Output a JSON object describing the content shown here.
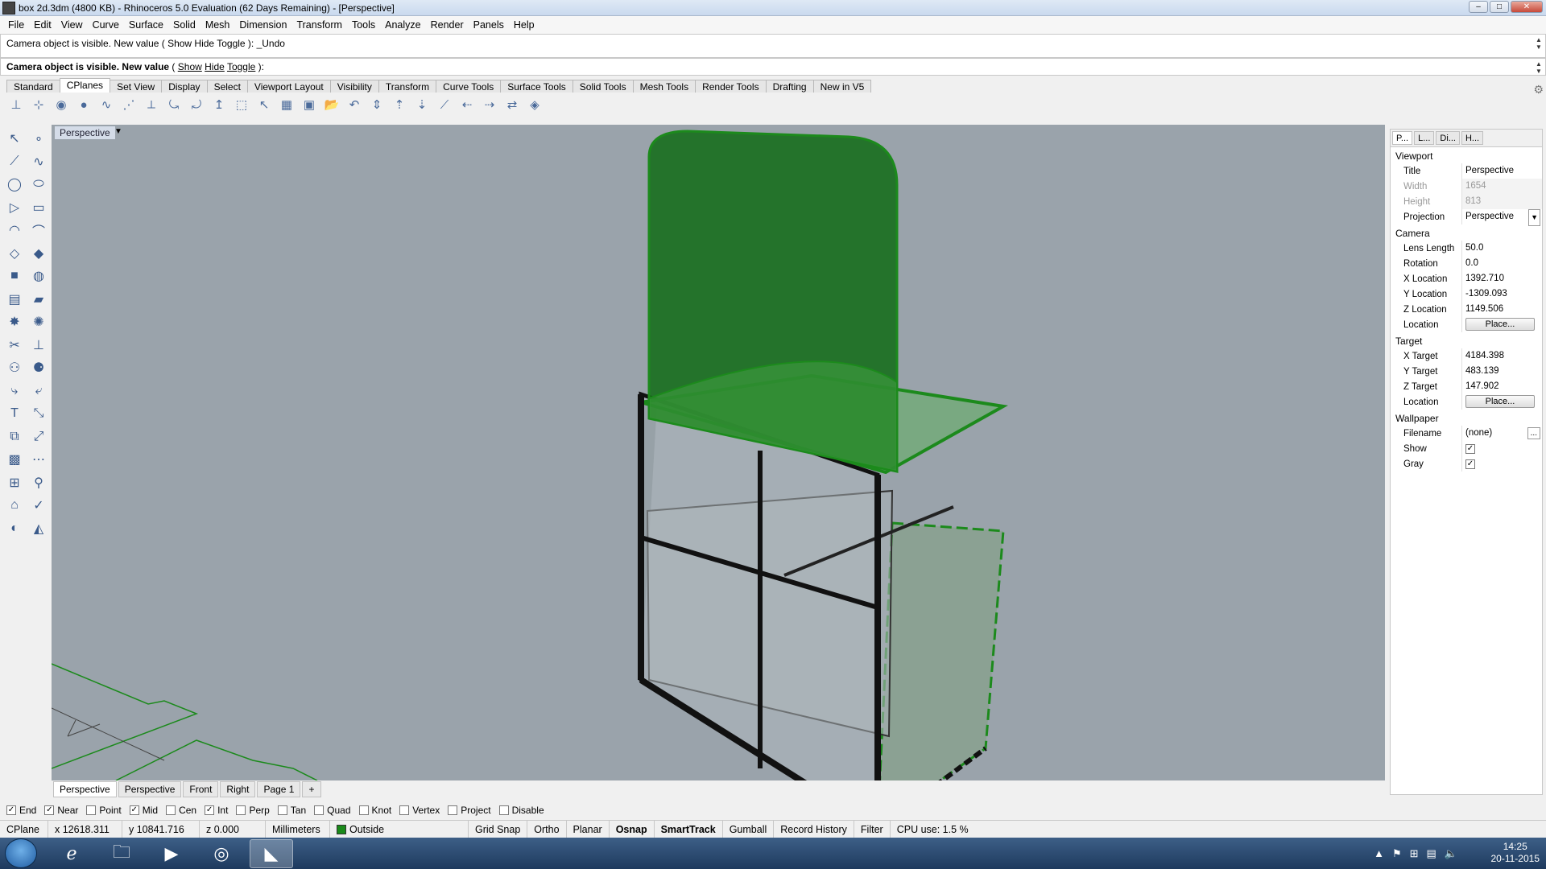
{
  "window": {
    "title": "box 2d.3dm (4800 KB) - Rhinoceros 5.0 Evaluation (62 Days Remaining) - [Perspective]",
    "btn_min": "–",
    "btn_max": "□",
    "btn_close": "✕"
  },
  "menu": [
    "File",
    "Edit",
    "View",
    "Curve",
    "Surface",
    "Solid",
    "Mesh",
    "Dimension",
    "Transform",
    "Tools",
    "Analyze",
    "Render",
    "Panels",
    "Help"
  ],
  "command": {
    "history": "Camera object is visible. New value ( Show  Hide  Toggle ): _Undo",
    "prompt_bold": "Camera object is visible. New value",
    "prompt_open": " ( ",
    "prompt_opt1": "Show",
    "prompt_opt2": "Hide",
    "prompt_opt3": "Toggle",
    "prompt_close": " ):"
  },
  "toolbar_tabs": [
    "Standard",
    "CPlanes",
    "Set View",
    "Display",
    "Select",
    "Viewport Layout",
    "Visibility",
    "Transform",
    "Curve Tools",
    "Surface Tools",
    "Solid Tools",
    "Mesh Tools",
    "Render Tools",
    "Drafting",
    "New in V5"
  ],
  "toolbar_active_tab": "CPlanes",
  "viewport": {
    "label": "Perspective",
    "bg_color": "#9aa3ab",
    "accent_green": "#1c8a1c",
    "tabs": [
      "Perspective",
      "Perspective",
      "Front",
      "Right",
      "Page 1",
      "+"
    ]
  },
  "properties": {
    "tabs": [
      "P...",
      "L...",
      "Di...",
      "H..."
    ],
    "viewport_header": "Viewport",
    "viewport": [
      {
        "key": "Title",
        "value": "Perspective"
      },
      {
        "key": "Width",
        "value": "1654"
      },
      {
        "key": "Height",
        "value": "813"
      },
      {
        "key": "Projection",
        "value": "Perspective"
      }
    ],
    "camera_header": "Camera",
    "camera": [
      {
        "key": "Lens Length",
        "value": "50.0"
      },
      {
        "key": "Rotation",
        "value": "0.0"
      },
      {
        "key": "X Location",
        "value": "1392.710"
      },
      {
        "key": "Y Location",
        "value": "-1309.093"
      },
      {
        "key": "Z Location",
        "value": "1149.506"
      },
      {
        "key": "Location",
        "value": "Place..."
      }
    ],
    "target_header": "Target",
    "target": [
      {
        "key": "X Target",
        "value": "4184.398"
      },
      {
        "key": "Y Target",
        "value": "483.139"
      },
      {
        "key": "Z Target",
        "value": "147.902"
      },
      {
        "key": "Location",
        "value": "Place..."
      }
    ],
    "wallpaper_header": "Wallpaper",
    "wallpaper": [
      {
        "key": "Filename",
        "value": "(none)"
      },
      {
        "key": "Show",
        "value": "✓"
      },
      {
        "key": "Gray",
        "value": "✓"
      }
    ],
    "browse": "..."
  },
  "osnaps": [
    {
      "label": "End",
      "checked": true
    },
    {
      "label": "Near",
      "checked": true
    },
    {
      "label": "Point",
      "checked": false
    },
    {
      "label": "Mid",
      "checked": true
    },
    {
      "label": "Cen",
      "checked": false
    },
    {
      "label": "Int",
      "checked": true
    },
    {
      "label": "Perp",
      "checked": false
    },
    {
      "label": "Tan",
      "checked": false
    },
    {
      "label": "Quad",
      "checked": false
    },
    {
      "label": "Knot",
      "checked": false
    },
    {
      "label": "Vertex",
      "checked": false
    },
    {
      "label": "Project",
      "checked": false
    },
    {
      "label": "Disable",
      "checked": false
    }
  ],
  "status": {
    "cplane": "CPlane",
    "x": "x 12618.311",
    "y": "y 10841.716",
    "z": "z 0.000",
    "units": "Millimeters",
    "layer": "Outside",
    "grid_snap": "Grid Snap",
    "ortho": "Ortho",
    "planar": "Planar",
    "osnap": "Osnap",
    "smarttrack": "SmartTrack",
    "gumball": "Gumball",
    "record_history": "Record History",
    "filter": "Filter",
    "cpu": "CPU use: 1.5 %"
  },
  "taskbar": {
    "time": "14:25",
    "date": "20-11-2015"
  }
}
